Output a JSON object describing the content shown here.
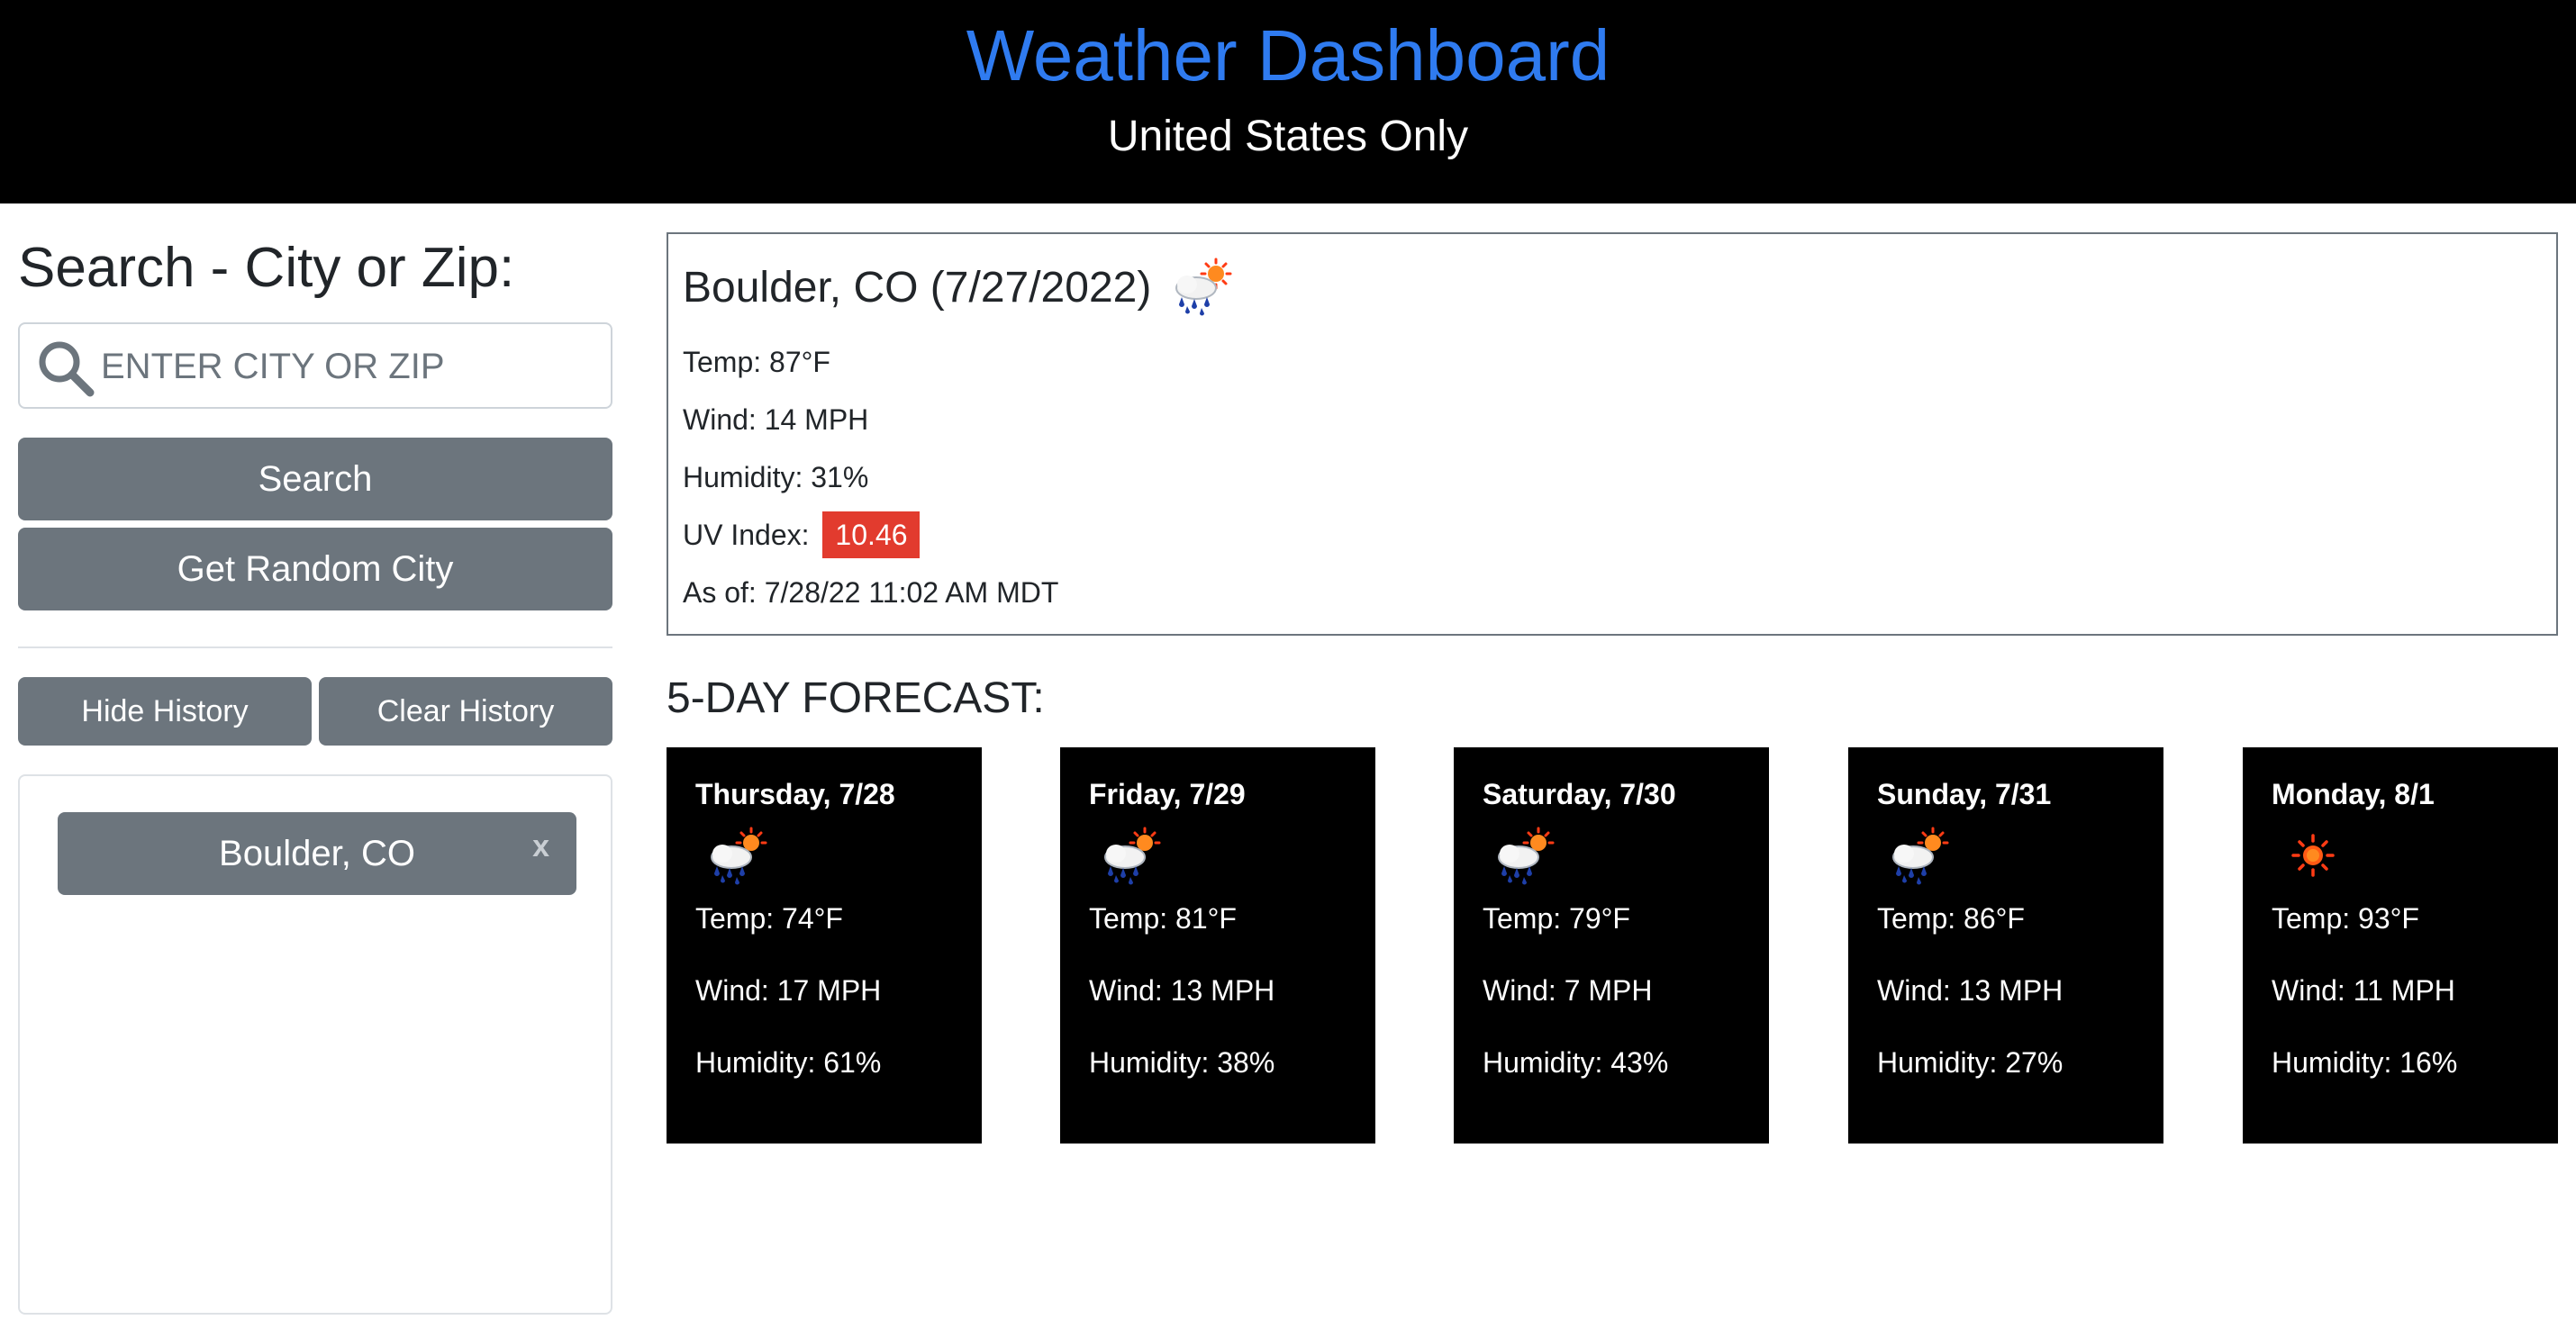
{
  "header": {
    "title": "Weather Dashboard",
    "subtitle": "United States Only"
  },
  "sidebar": {
    "heading": "Search - City or Zip:",
    "search_placeholder": "ENTER CITY OR ZIP",
    "search_value": "",
    "search_button": "Search",
    "random_button": "Get Random City",
    "hide_history_button": "Hide History",
    "clear_history_button": "Clear History",
    "history": [
      {
        "label": "Boulder, CO",
        "remove": "x"
      }
    ]
  },
  "current": {
    "city_date": "Boulder, CO (7/27/2022)",
    "icon": "rain-sun-icon",
    "temp": "Temp: 87°F",
    "wind": "Wind: 14 MPH",
    "humidity": "Humidity: 31%",
    "uv_label": "UV Index:",
    "uv_value": "10.46",
    "uv_color": "#e23b2e",
    "as_of": "As of: 7/28/22 11:02 AM MDT"
  },
  "forecast": {
    "heading": "5-DAY FORECAST:",
    "days": [
      {
        "day": "Thursday, 7/28",
        "icon": "rain-sun-icon",
        "temp": "Temp: 74°F",
        "wind": "Wind: 17 MPH",
        "humidity": "Humidity: 61%"
      },
      {
        "day": "Friday, 7/29",
        "icon": "rain-sun-icon",
        "temp": "Temp: 81°F",
        "wind": "Wind: 13 MPH",
        "humidity": "Humidity: 38%"
      },
      {
        "day": "Saturday, 7/30",
        "icon": "rain-sun-icon",
        "temp": "Temp: 79°F",
        "wind": "Wind: 7 MPH",
        "humidity": "Humidity: 43%"
      },
      {
        "day": "Sunday, 7/31",
        "icon": "rain-sun-icon",
        "temp": "Temp: 86°F",
        "wind": "Wind: 13 MPH",
        "humidity": "Humidity: 27%"
      },
      {
        "day": "Monday, 8/1",
        "icon": "sun-icon",
        "temp": "Temp: 93°F",
        "wind": "Wind: 11 MPH",
        "humidity": "Humidity: 16%"
      }
    ]
  },
  "colors": {
    "title_blue": "#2f7bf0",
    "button_gray": "#6c757d",
    "header_bg": "#000000"
  }
}
